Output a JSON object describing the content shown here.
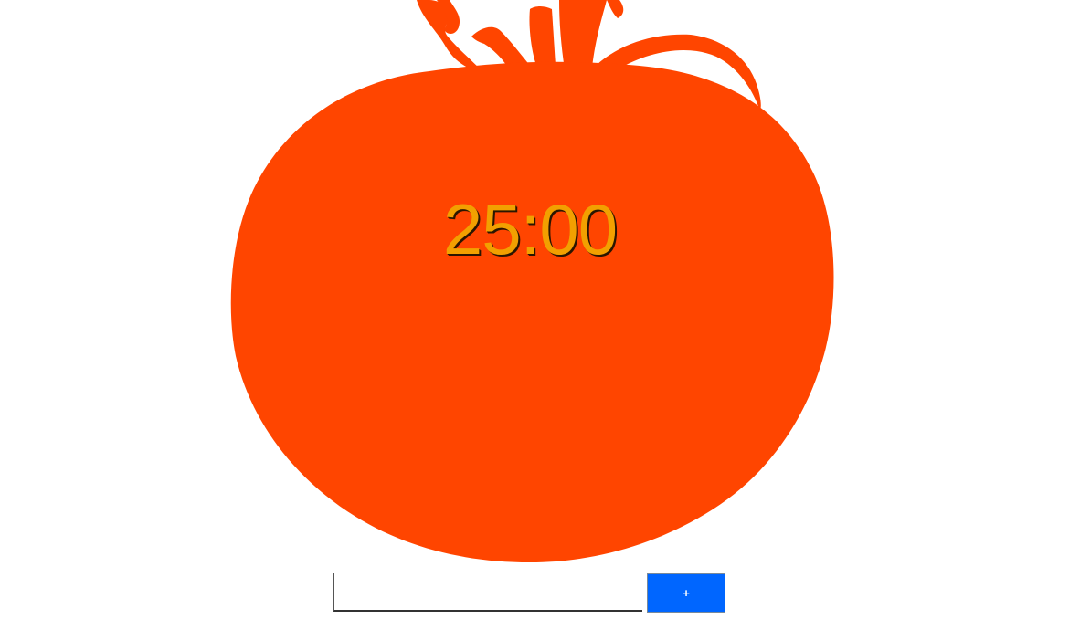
{
  "colors": {
    "tomato": "#ff4500",
    "timer_text": "#f2a000",
    "timer_shadow": "#2b1600",
    "button": "#0066ff",
    "background": "#ffffff"
  },
  "timer": {
    "display": "25:00"
  },
  "task_form": {
    "input_value": "",
    "input_placeholder": "",
    "add_label": "+"
  }
}
